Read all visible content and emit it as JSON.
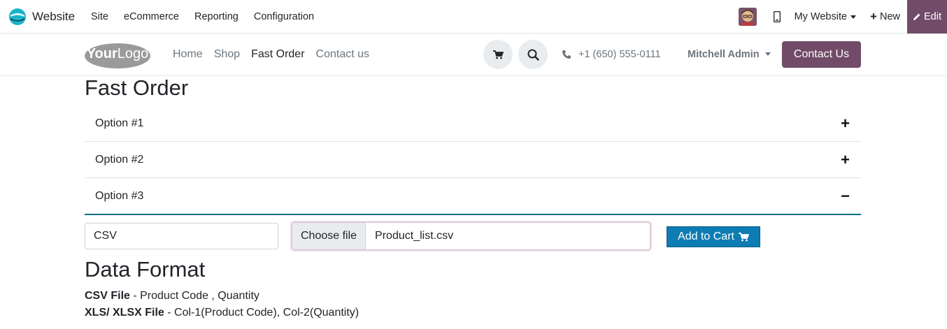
{
  "admin_bar": {
    "app_name": "Website",
    "menu": [
      "Site",
      "eCommerce",
      "Reporting",
      "Configuration"
    ],
    "website_switcher": "My Website",
    "new_label": "New",
    "edit_label": "Edit",
    "accent_color": "#714b67"
  },
  "site_header": {
    "logo_text": "YourLogo",
    "nav": [
      {
        "label": "Home",
        "active": false
      },
      {
        "label": "Shop",
        "active": false
      },
      {
        "label": "Fast Order",
        "active": true
      },
      {
        "label": "Contact us",
        "active": false
      }
    ],
    "phone": "+1 (650) 555-0111",
    "user_name": "Mitchell Admin",
    "contact_button": "Contact Us"
  },
  "main": {
    "title": "Fast Order",
    "options": [
      {
        "label": "Option #1",
        "sign": "+",
        "open": false
      },
      {
        "label": "Option #2",
        "sign": "+",
        "open": false
      },
      {
        "label": "Option #3",
        "sign": "−",
        "open": true
      }
    ],
    "format_value": "CSV",
    "choose_file_label": "Choose file",
    "file_name": "Product_list.csv",
    "add_to_cart_label": "Add to Cart",
    "data_format_title": "Data Format",
    "csv_label": "CSV File",
    "csv_desc": " - Product Code , Quantity",
    "xls_label": "XLS/ XLSX File",
    "xls_desc": " - Col-1(Product Code), Col-2(Quantity)"
  }
}
